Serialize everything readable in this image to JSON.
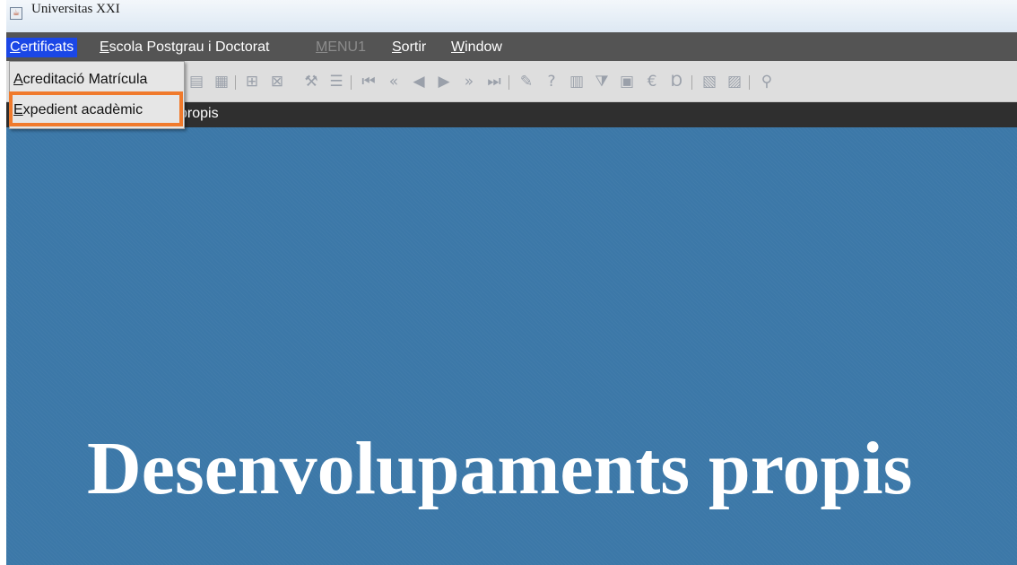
{
  "window": {
    "title": "Universitas XXI"
  },
  "menubar": {
    "items": [
      {
        "label_prefix": "C",
        "label_rest": "ertificats"
      },
      {
        "label_prefix": "E",
        "label_rest": "scola Postgrau i Doctorat"
      },
      {
        "label_prefix": "M",
        "label_rest": "ENU1"
      },
      {
        "label_prefix": "S",
        "label_rest": "ortir"
      },
      {
        "label_prefix": "W",
        "label_rest": "indow"
      }
    ]
  },
  "dropdown": {
    "items": [
      {
        "label_prefix": "A",
        "label_rest": "creditació Matrícula"
      },
      {
        "label_prefix": "E",
        "label_rest": "xpedient acadèmic"
      }
    ]
  },
  "toolbar": {
    "icons": [
      "save-icon",
      "undo-icon",
      "separator",
      "add-record-icon",
      "delete-record-icon",
      "separator",
      "wrench-icon",
      "list-icon",
      "separator",
      "first-icon",
      "prev-page-icon",
      "prev-icon",
      "next-icon",
      "next-page-icon",
      "last-icon",
      "separator",
      "edit-icon",
      "help-icon",
      "query-icon",
      "filter-icon",
      "calendar-icon",
      "euro-icon",
      "font-icon",
      "separator",
      "report-icon",
      "report-alt-icon",
      "separator",
      "tool-icon"
    ]
  },
  "form_strip": {
    "text": "propis"
  },
  "canvas": {
    "banner": "Desenvolupaments propis"
  },
  "colors": {
    "menubar_bg": "#545454",
    "menu_active": "#1b47e6",
    "canvas_bg": "#3c78a8",
    "highlight": "#f07a2c"
  }
}
